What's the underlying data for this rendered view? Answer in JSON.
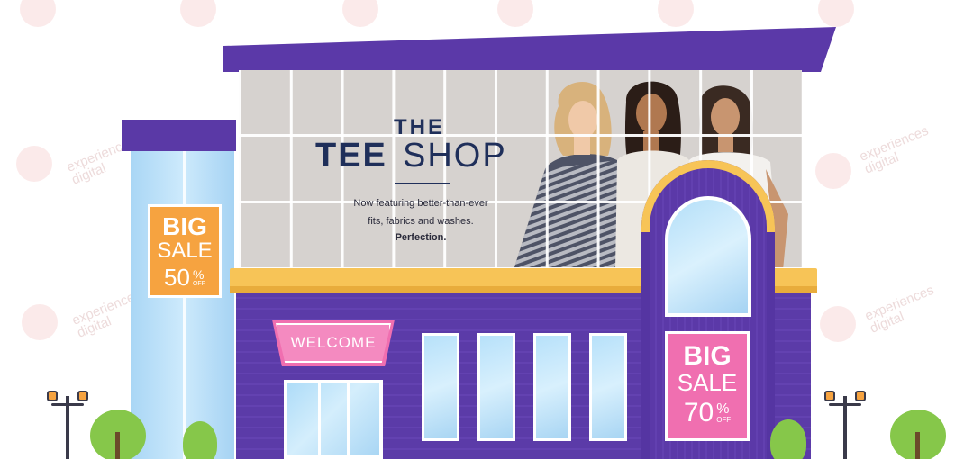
{
  "billboard": {
    "title_line1": "THE",
    "title_tee": "TEE",
    "title_shop": "SHOP",
    "tagline_line1": "Now featuring better-than-ever",
    "tagline_line2": "fits, fabrics and washes.",
    "tagline_line3": "Perfection."
  },
  "welcome_sign": "WELCOME",
  "sale_left": {
    "big": "BIG",
    "sale": "SALE",
    "number": "50",
    "percent": "%",
    "off": "OFF"
  },
  "sale_right": {
    "big": "BIG",
    "sale": "SALE",
    "number": "70",
    "percent": "%",
    "off": "OFF"
  },
  "watermark": {
    "line1": "experiences",
    "line2": "digital"
  },
  "colors": {
    "building_purple": "#5b39a8",
    "awning_orange": "#f7c457",
    "sale_orange": "#f6a340",
    "sale_pink": "#f06fb0",
    "glass_blue": "#b7e1fa",
    "tree_green": "#86c74a",
    "billboard_text_navy": "#1f2f5a"
  }
}
